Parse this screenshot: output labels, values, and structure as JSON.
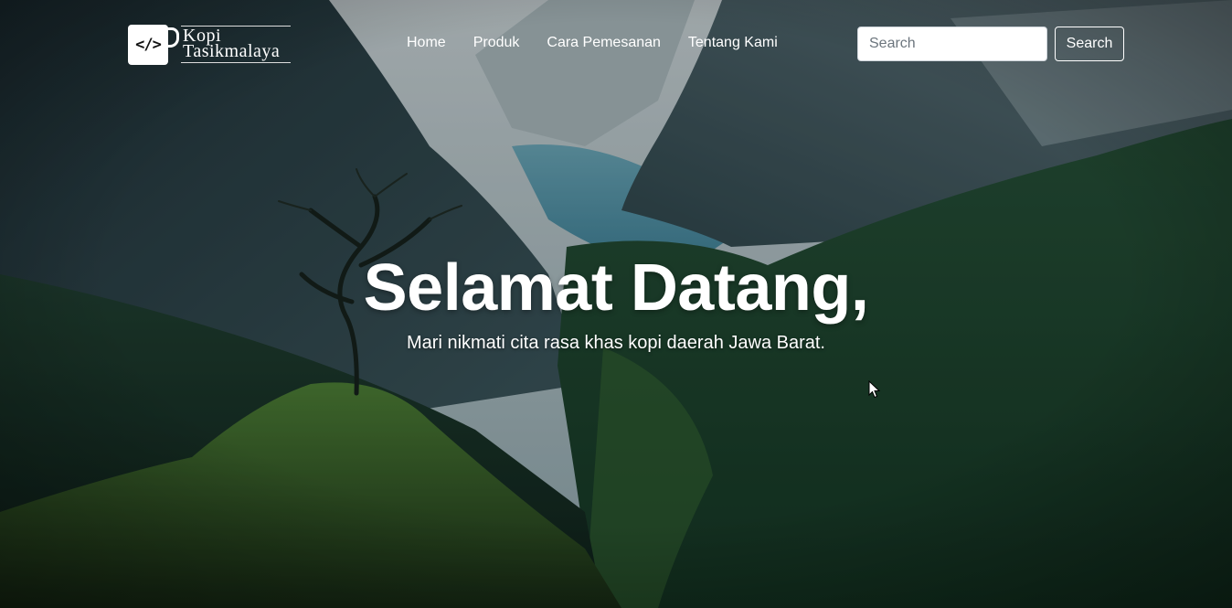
{
  "logo": {
    "icon_text": "</>",
    "line1": "Kopi",
    "line2": "Tasikmalaya"
  },
  "nav": {
    "items": [
      {
        "label": "Home"
      },
      {
        "label": "Produk"
      },
      {
        "label": "Cara Pemesanan"
      },
      {
        "label": "Tentang Kami"
      }
    ]
  },
  "search": {
    "placeholder": "Search",
    "button_label": "Search"
  },
  "hero": {
    "title": "Selamat Datang,",
    "subtitle": "Mari nikmati cita rasa khas kopi daerah Jawa Barat.",
    "background": "mountain-valley-forest-photo"
  },
  "colors": {
    "text": "#ffffff",
    "sky": "#b9c2c4",
    "lake": "#4e8fa6",
    "forest_dark": "#12281a",
    "forest_light": "#3f7d2c"
  }
}
